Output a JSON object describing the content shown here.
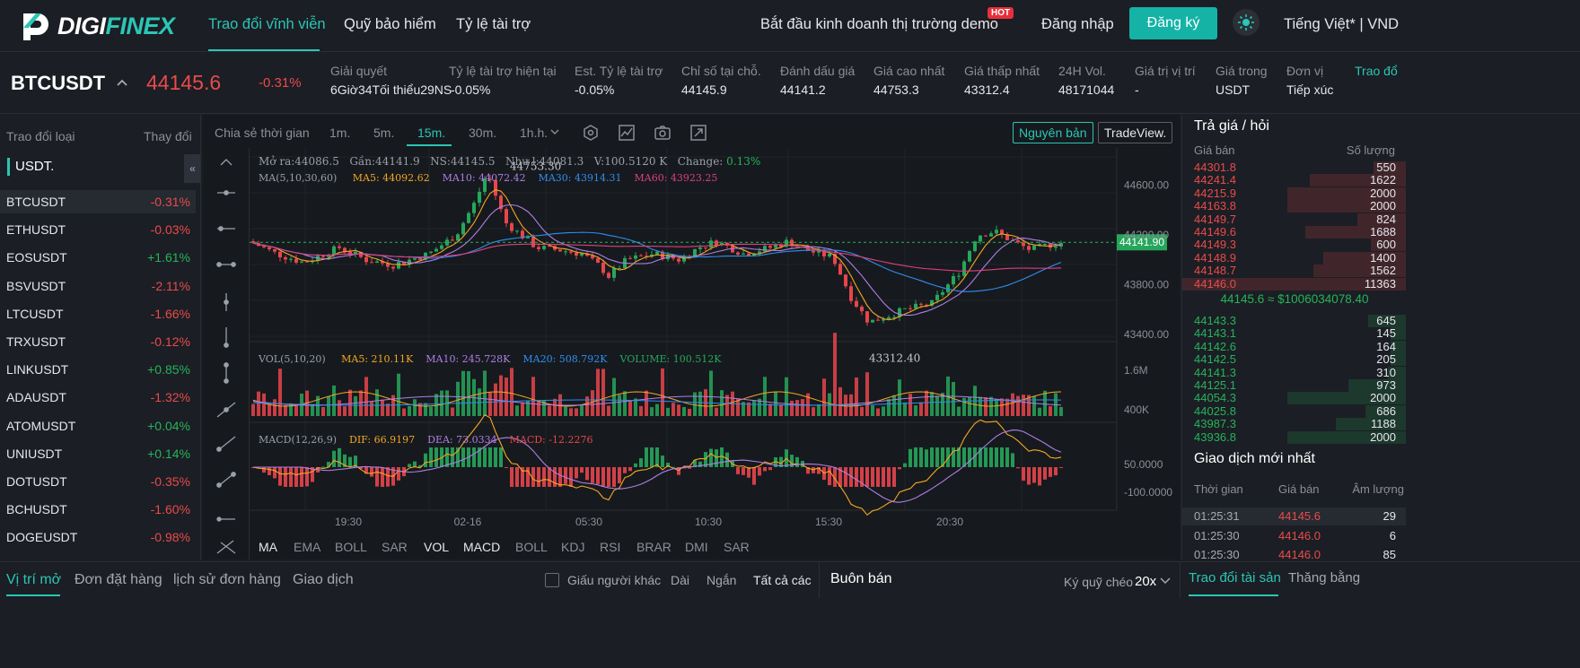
{
  "nav": {
    "logo": "DIGIFINEX",
    "items": [
      "Trao đổi vĩnh viễn",
      "Quỹ bảo hiểm",
      "Tỷ lệ tài trợ"
    ],
    "demo": "Bắt đầu kinh doanh thị trường demo",
    "hot": "HOT",
    "login": "Đăng nhập",
    "register": "Đăng ký",
    "lang": "Tiếng Việt* | VND"
  },
  "ticker": {
    "symbol": "BTCUSDT",
    "price": "44145.6",
    "change": "-0.31%",
    "stats": [
      {
        "label": "Giải quyết",
        "value": "6Giờ34Tối thiểu29NS"
      },
      {
        "label": "Tỷ lệ tài trợ hiện tại",
        "value": "-0.05%"
      },
      {
        "label": "Est. Tỷ lệ tài trợ",
        "value": "-0.05%"
      },
      {
        "label": "Chỉ số tại chỗ.",
        "value": "44145.9"
      },
      {
        "label": "Đánh dấu giá",
        "value": "44141.2"
      },
      {
        "label": "Giá cao nhất",
        "value": "44753.3"
      },
      {
        "label": "Giá thấp nhất",
        "value": "43312.4"
      },
      {
        "label": "24H Vol.",
        "value": "48171044"
      },
      {
        "label": "Giá trị vị trí",
        "value": "-"
      },
      {
        "label": "Giá trong",
        "value": "USDT"
      },
      {
        "label": "Đơn vị",
        "value": "Tiếp xúc"
      },
      {
        "label": "Trao đổ",
        "value": ""
      }
    ]
  },
  "markets": {
    "header_left": "Trao đổi loại",
    "header_right": "Thay đổi",
    "tab": "USDT.",
    "collapse": "«",
    "rows": [
      {
        "sym": "BTCUSDT",
        "chg": "-0.31%"
      },
      {
        "sym": "ETHUSDT",
        "chg": "-0.03%"
      },
      {
        "sym": "EOSUSDT",
        "chg": "+1.61%"
      },
      {
        "sym": "BSVUSDT",
        "chg": "-2.11%"
      },
      {
        "sym": "LTCUSDT",
        "chg": "-1.66%"
      },
      {
        "sym": "TRXUSDT",
        "chg": "-0.12%"
      },
      {
        "sym": "LINKUSDT",
        "chg": "+0.85%"
      },
      {
        "sym": "ADAUSDT",
        "chg": "-1.32%"
      },
      {
        "sym": "ATOMUSDT",
        "chg": "+0.04%"
      },
      {
        "sym": "UNIUSDT",
        "chg": "+0.14%"
      },
      {
        "sym": "DOTUSDT",
        "chg": "-0.35%"
      },
      {
        "sym": "BCHUSDT",
        "chg": "-1.60%"
      },
      {
        "sym": "DOGEUSDT",
        "chg": "-0.98%"
      }
    ]
  },
  "chart": {
    "timeframes": [
      "Chia sẻ thời gian",
      "1m.",
      "5m.",
      "15m.",
      "30m.",
      "1h.h."
    ],
    "active_tf": "15m.",
    "btn_original": "Nguyên bản",
    "btn_tradeview": "TradeView.",
    "info": {
      "open": "Mở ra:44086.5",
      "close": "Gần:44141.9",
      "high": "NS:44145.5",
      "low": "Như l:44081.3",
      "vol": "V:100.5120 K",
      "change_label": "Change:",
      "change_val": "0.13%"
    },
    "ma_line": {
      "title": "MA(5,10,30,60)",
      "ma5": "MA5: 44092.62",
      "ma10": "MA10: 44072.42",
      "ma30": "MA30: 43914.31",
      "ma60": "MA60: 43923.25"
    },
    "vol_line": {
      "title": "VOL(5,10,20)",
      "ma5": "MA5: 210.11K",
      "ma10": "MA10: 245.728K",
      "ma20": "MA20: 508.792K",
      "volume": "VOLUME: 100.512K"
    },
    "macd_line": {
      "title": "MACD(12,26,9)",
      "dif": "DIF: 66.9197",
      "dea": "DEA: 73.0334",
      "macd": "MACD: -12.2276"
    },
    "price_ticks": [
      "44600.00",
      "44200.00",
      "43800.00",
      "43400.00"
    ],
    "vol_ticks": [
      "1.6M",
      "400K"
    ],
    "macd_ticks": [
      "50.0000",
      "-100.0000"
    ],
    "time_ticks": [
      "19:30",
      "02-16",
      "05:30",
      "10:30",
      "15:30",
      "20:30"
    ],
    "high_label": "44753.30",
    "low_label": "43312.40",
    "last_price": "44141.90",
    "indicators_main": [
      "MA",
      "EMA",
      "BOLL",
      "SAR"
    ],
    "indicators_sub": [
      "VOL",
      "MACD",
      "BOLL",
      "KDJ",
      "RSI",
      "BRAR",
      "DMI",
      "SAR"
    ],
    "colors": {
      "up": "#26a65b",
      "down": "#e8454b",
      "ma5": "#f5a623",
      "ma10": "#b07ee6",
      "ma30": "#2f8ef0",
      "ma60": "#e03f7f"
    }
  },
  "chart_data": {
    "type": "candlestick",
    "title": "BTCUSDT 15m",
    "ylim": [
      43200,
      44900
    ],
    "high": 44753.3,
    "low": 43312.4,
    "last": 44141.9,
    "x": [
      "19:30",
      "02-16",
      "05:30",
      "10:30",
      "15:30",
      "20:30"
    ]
  },
  "orderbook": {
    "title": "Trả giá / hỏi",
    "col_price": "Giá bán",
    "col_qty": "Số lượng",
    "asks": [
      [
        "44301.8",
        "550"
      ],
      [
        "44241.4",
        "1622"
      ],
      [
        "44215.9",
        "2000"
      ],
      [
        "44163.8",
        "2000"
      ],
      [
        "44149.7",
        "824"
      ],
      [
        "44149.6",
        "1688"
      ],
      [
        "44149.3",
        "600"
      ],
      [
        "44148.9",
        "1400"
      ],
      [
        "44148.7",
        "1562"
      ],
      [
        "44146.0",
        "11363"
      ]
    ],
    "mid": "44145.6 ≈ $1006034078.40",
    "bids": [
      [
        "44143.3",
        "645"
      ],
      [
        "44143.1",
        "145"
      ],
      [
        "44142.6",
        "164"
      ],
      [
        "44142.5",
        "205"
      ],
      [
        "44141.3",
        "310"
      ],
      [
        "44125.1",
        "973"
      ],
      [
        "44054.3",
        "2000"
      ],
      [
        "44025.8",
        "686"
      ],
      [
        "43987.3",
        "1188"
      ],
      [
        "43936.8",
        "2000"
      ]
    ],
    "trades_title": "Giao dịch mới nhất",
    "trades_cols": [
      "Thời gian",
      "Giá bán",
      "Âm lượng"
    ],
    "trades": [
      [
        "01:25:31",
        "44145.6",
        "29"
      ],
      [
        "01:25:30",
        "44146.0",
        "6"
      ],
      [
        "01:25:30",
        "44146.0",
        "85"
      ]
    ]
  },
  "bottom": {
    "tabs": [
      "Vị trí mở",
      "Đơn đặt hàng",
      "lịch sử đơn hàng",
      "Giao dịch"
    ],
    "hide_others": "Giấu người khác",
    "long": "Dài",
    "short": "Ngắn",
    "all": "Tất cả các",
    "trade_title": "Buôn bán",
    "margin": "Ký quỹ chéo",
    "leverage": "20x",
    "tab_assets": "Trao đổi tài sản",
    "tab_balance": "Thăng bằng"
  }
}
